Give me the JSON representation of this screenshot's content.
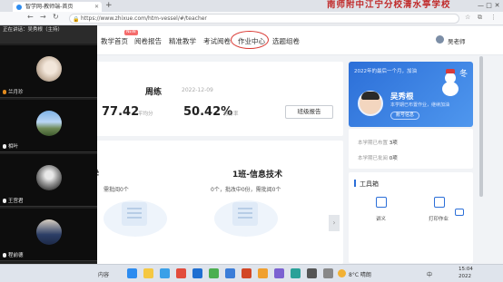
{
  "browser": {
    "tab_title": "智学网-教师端-首页",
    "url": "https://www.zhixue.com/htm-vessel/#/teacher",
    "window_title": "南师附中江宁分校清水亭学校",
    "new_tab": "+",
    "win_controls": [
      "—",
      "□",
      "✕"
    ]
  },
  "nav": {
    "items": [
      "教学首页",
      "阅卷报告",
      "精准教学",
      "考试阅卷",
      "作业中心",
      "选题组卷"
    ],
    "new_badge": "NEW",
    "user_name": "吴老师"
  },
  "weekly": {
    "title": "周练",
    "date": "2022-12-09",
    "score": "77.42",
    "score_label": "平均分",
    "rate": "50.42%",
    "rate_label": "得分率",
    "report_button": "班级报告"
  },
  "classes": [
    {
      "title": "学",
      "sub": "需批阅0个"
    },
    {
      "title": "1班-信息技术",
      "sub": "0个，批改中0份，需批阅0个"
    }
  ],
  "profile": {
    "greeting": "2022年的最后一个月，加油",
    "name": "吴秀根",
    "subtitle": "本学期已布置作业，继续加油",
    "button": "账号信息",
    "season": "冬"
  },
  "stats": [
    {
      "label": "本学期已布置",
      "value": "3项"
    },
    {
      "label": "本学期已批阅",
      "value": "0项"
    }
  ],
  "tools": {
    "title": "工具箱",
    "items": [
      "讲义",
      "打印作业"
    ]
  },
  "meeting": {
    "header": [
      "正在讲话：吴秀根（主持）",
      ""
    ],
    "participants": [
      {
        "name": "兰月珍",
        "mic_on": true
      },
      {
        "name": "相叶",
        "mic_on": false
      },
      {
        "name": "王宫君",
        "mic_on": false
      },
      {
        "name": "程前德",
        "mic_on": false
      }
    ],
    "more": "⌄"
  },
  "taskbar": {
    "app_label": "内容",
    "weather": "8°C 晴朗",
    "time": "15:04",
    "date": "2022",
    "ime": "中"
  },
  "colors": {
    "accent": "#2c6fd8",
    "nav_highlight_circle": "#d9352f",
    "title_red": "#c02a2a"
  }
}
